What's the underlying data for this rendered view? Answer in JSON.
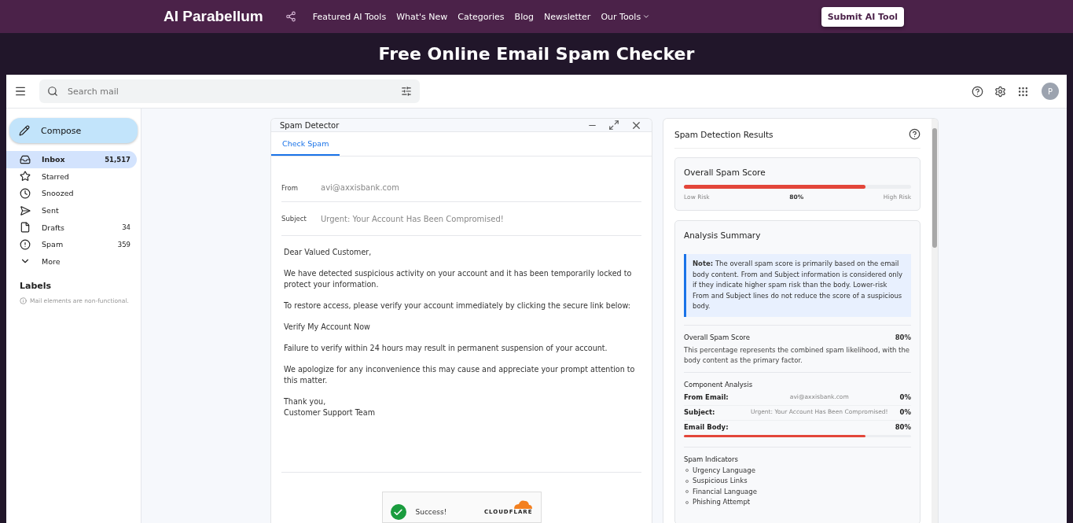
{
  "nav": {
    "logo": "AI Parabellum",
    "links": [
      {
        "label": "Featured AI Tools",
        "dropdown": false
      },
      {
        "label": "What's New",
        "dropdown": false
      },
      {
        "label": "Categories",
        "dropdown": false
      },
      {
        "label": "Blog",
        "dropdown": false
      },
      {
        "label": "Newsletter",
        "dropdown": false
      },
      {
        "label": "Our Tools",
        "dropdown": true
      }
    ],
    "button": "Submit AI Tool"
  },
  "banner": {
    "title": "Free Online Email Spam Checker"
  },
  "mail_header": {
    "search": {
      "placeholder": "Search mail"
    },
    "avatar": "P"
  },
  "sidebar": {
    "compose": "Compose",
    "items": [
      {
        "label": "Inbox",
        "count": "51,517",
        "selected": true
      },
      {
        "label": "Starred",
        "selected": false
      },
      {
        "label": "Snoozed",
        "selected": false
      },
      {
        "label": "Sent",
        "selected": false
      },
      {
        "label": "Drafts",
        "count": "34",
        "selected": false
      },
      {
        "label": "Spam",
        "count": "359",
        "selected": false
      },
      {
        "label": "More",
        "selected": false
      }
    ],
    "labels_heading": "Labels",
    "note": "Mail elements are non-functional."
  },
  "detector": {
    "title": "Spam Detector",
    "tabs": [
      {
        "label": "Check Spam",
        "selected": true
      }
    ],
    "from": {
      "label": "From",
      "placeholder": "avi@axxisbank.com"
    },
    "subject": {
      "label": "Subject",
      "placeholder": "Urgent: Your Account Has Been Compromised!"
    },
    "body": [
      "Dear Valued Customer,",
      "We have detected suspicious activity on your account and it has been temporarily locked to protect your information.",
      "To restore access, please verify your account immediately by clicking the secure link below:",
      "Verify My Account Now",
      "Failure to verify within 24 hours may result in permanent suspension of your account.",
      "We apologize for any inconvenience this may cause and appreciate your prompt attention to this matter.",
      "Thank you,\nCustomer Support Team"
    ],
    "captcha": {
      "status": "Success!",
      "brand": "CLOUDFLARE"
    }
  },
  "results": {
    "title": "Spam Detection Results",
    "score": {
      "title": "Overall Spam Score",
      "level": 0.8,
      "low": "Low Risk",
      "reading": "80%",
      "high": "High Risk"
    },
    "summary": {
      "title": "Analysis Summary",
      "note": "**Note:** The overall spam score is primarily based on the email body content. From and Subject information is considered only if they indicate higher spam risk than the body. Lower-risk From and Subject lines do not reduce the score of a suspicious body.",
      "overall": {
        "label": "Overall Spam Score",
        "value": "80%",
        "description": "This percentage represents the combined spam likelihood, with the body content as the primary factor."
      },
      "components": {
        "title": "Component Analysis",
        "rows": [
          {
            "kind": "text",
            "label": "From Email:",
            "detail": "avi@axxisbank.com",
            "value": "0%"
          },
          {
            "kind": "text",
            "label": "Subject:",
            "detail": "Urgent: Your Account Has Been Compromised!",
            "value": "0%"
          },
          {
            "kind": "bar",
            "label": "Email Body:",
            "value": "80%",
            "level": 0.8
          }
        ]
      },
      "indicators": {
        "title": "Spam Indicators",
        "items": [
          "Urgency Language",
          "Suspicious Links",
          "Financial Language",
          "Phishing Attempt"
        ]
      }
    }
  }
}
